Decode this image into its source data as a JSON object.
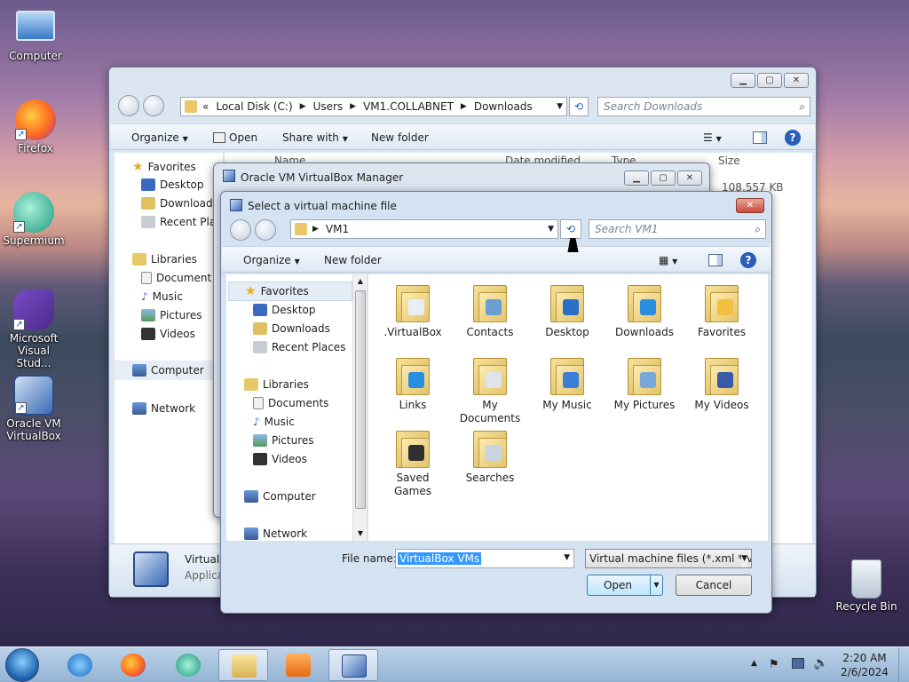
{
  "desktop": {
    "icons": [
      {
        "label": "Computer",
        "icon": "computer-icon"
      },
      {
        "label": "Firefox",
        "icon": "firefox-icon"
      },
      {
        "label": "Supermium",
        "icon": "supermium-icon"
      },
      {
        "label": "Microsoft Visual Stud...",
        "icon": "visual-studio-icon"
      },
      {
        "label": "Oracle VM VirtualBox",
        "icon": "virtualbox-icon"
      },
      {
        "label": "Recycle Bin",
        "icon": "recycle-bin-icon"
      }
    ]
  },
  "explorer": {
    "breadcrumb": {
      "prefix": "«",
      "parts": [
        "Local Disk (C:)",
        "Users",
        "VM1.COLLABNET",
        "Downloads"
      ]
    },
    "search_placeholder": "Search Downloads",
    "toolbar": {
      "organize": "Organize",
      "open": "Open",
      "share_with": "Share with",
      "new_folder": "New folder"
    },
    "columns": {
      "name": "Name",
      "date": "Date modified",
      "type": "Type",
      "size": "Size"
    },
    "first_row_size": "108,557 KB",
    "nav": {
      "favorites": "Favorites",
      "desktop": "Desktop",
      "downloads": "Downloads",
      "recent": "Recent Plac",
      "libraries": "Libraries",
      "documents": "Document",
      "music": "Music",
      "pictures": "Pictures",
      "videos": "Videos",
      "computer": "Computer",
      "network": "Network"
    },
    "details": {
      "name": "VirtualB",
      "type": "Applicat"
    }
  },
  "vbox_manager": {
    "title": "Oracle VM VirtualBox Manager"
  },
  "dialog": {
    "title": "Select a virtual machine file",
    "path": "VM1",
    "search_placeholder": "Search VM1",
    "toolbar": {
      "organize": "Organize",
      "new_folder": "New folder"
    },
    "nav": {
      "favorites": "Favorites",
      "desktop": "Desktop",
      "downloads": "Downloads",
      "recent": "Recent Places",
      "libraries": "Libraries",
      "documents": "Documents",
      "music": "Music",
      "pictures": "Pictures",
      "videos": "Videos",
      "computer": "Computer",
      "network": "Network"
    },
    "folders": [
      {
        "name": ".VirtualBox",
        "symbol": "#e8eef6"
      },
      {
        "name": "Contacts",
        "symbol": "#6aa0d0"
      },
      {
        "name": "Desktop",
        "symbol": "#2a6ec8"
      },
      {
        "name": "Downloads",
        "symbol": "#2a8ee0"
      },
      {
        "name": "Favorites",
        "symbol": "#f2c040"
      },
      {
        "name": "Links",
        "symbol": "#2a8ee0"
      },
      {
        "name": "My Documents",
        "symbol": "#e0e4ea"
      },
      {
        "name": "My Music",
        "symbol": "#3a7ed8"
      },
      {
        "name": "My Pictures",
        "symbol": "#78a8d8"
      },
      {
        "name": "My Videos",
        "symbol": "#3a5aa8"
      },
      {
        "name": "Saved Games",
        "symbol": "#303030"
      },
      {
        "name": "Searches",
        "symbol": "#c8d4e0"
      }
    ],
    "file_name_label": "File name:",
    "file_name_value": "VirtualBox VMs",
    "filter": "Virtual machine files (*.xml *.vb",
    "open": "Open",
    "cancel": "Cancel"
  },
  "taskbar": {
    "time": "2:20 AM",
    "date": "2/6/2024",
    "apps": [
      "start-orb",
      "internet-explorer",
      "firefox",
      "supermium",
      "file-explorer",
      "media-player",
      "virtualbox"
    ]
  },
  "colors": {
    "accent": "#3399ff",
    "selection": "#3399ff",
    "window_frame": "#dce6f1"
  }
}
